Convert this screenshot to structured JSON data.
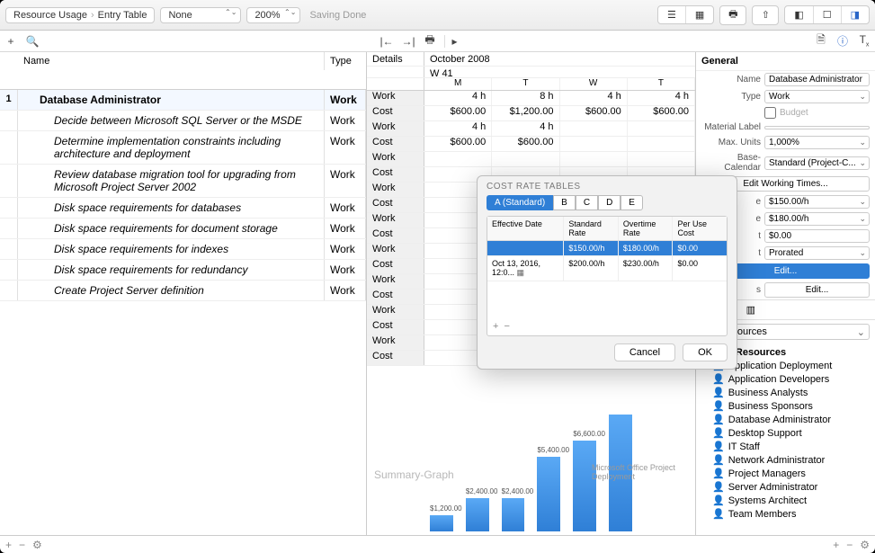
{
  "toolbar": {
    "breadcrumb": [
      "Resource Usage",
      "Entry Table"
    ],
    "filter": "None",
    "zoom": "200%",
    "saving": "Saving Done"
  },
  "left": {
    "headers": {
      "name": "Name",
      "type": "Type"
    },
    "main": {
      "id": "1",
      "name": "Database Administrator",
      "type": "Work"
    },
    "tasks": [
      {
        "name": "Decide between Microsoft SQL Server or the MSDE",
        "type": "Work"
      },
      {
        "name": "Determine implementation constraints including architecture and deployment",
        "type": "Work"
      },
      {
        "name": "Review database migration tool for upgrading from Microsoft Project Server 2002",
        "type": "Work"
      },
      {
        "name": "Disk space requirements for databases",
        "type": "Work"
      },
      {
        "name": "Disk space requirements for document storage",
        "type": "Work"
      },
      {
        "name": "Disk space requirements for indexes",
        "type": "Work"
      },
      {
        "name": "Disk space requirements for redundancy",
        "type": "Work"
      },
      {
        "name": "Create Project Server  definition",
        "type": "Work"
      }
    ]
  },
  "mid": {
    "details_label": "Details",
    "month": "October 2008",
    "week": "W 41",
    "days": [
      "M",
      "T",
      "W",
      "T"
    ],
    "work_label": "Work",
    "cost_label": "Cost",
    "main_work": [
      "4 h",
      "8 h",
      "4 h",
      "4 h"
    ],
    "main_cost": [
      "$600.00",
      "$1,200.00",
      "$600.00",
      "$600.00"
    ],
    "t1_work": [
      "4 h",
      "4 h",
      "",
      ""
    ],
    "t1_cost": [
      "$600.00",
      "$600.00",
      "",
      ""
    ]
  },
  "chart_data": {
    "type": "bar",
    "label": "Summary-Graph",
    "sublabel": "Microsoft Office Project  Deployment",
    "values": [
      1200,
      2400,
      2400,
      5400,
      6600,
      8500
    ],
    "labels": [
      "$1,200.00",
      "$2,400.00",
      "$2,400.00",
      "$5,400.00",
      "$6,600.00",
      ""
    ]
  },
  "inspector": {
    "general": "General",
    "name_label": "Name",
    "name": "Database Administrator",
    "type_label": "Type",
    "type": "Work",
    "budget": "Budget",
    "matlabel_label": "Material Label",
    "matlabel": "",
    "maxunits_label": "Max. Units",
    "maxunits": "1,000%",
    "basecal_label": "Base-Calendar",
    "basecal": "Standard (Project-C...",
    "editwt": "Edit Working Times...",
    "rate1": "$150.00/h",
    "rate2": "$180.00/h",
    "cost0": "$0.00",
    "prorated": "Prorated",
    "edit": "Edit...",
    "allres": "All Resources",
    "treeroot": "Work Resources",
    "tree": [
      "Application Deployment",
      "Application Developers",
      "Business Analysts",
      "Business Sponsors",
      "Database Administrator",
      "Desktop Support",
      "IT Staff",
      "Network Administrator",
      "Project Managers",
      "Server Administrator",
      "Systems Architect",
      "Team Members"
    ]
  },
  "popover": {
    "title": "COST RATE TABLES",
    "tabs": [
      "A (Standard)",
      "B",
      "C",
      "D",
      "E"
    ],
    "headers": [
      "Effective Date",
      "Standard Rate",
      "Overtime Rate",
      "Per Use Cost"
    ],
    "rows": [
      {
        "date": "",
        "std": "$150.00/h",
        "ot": "$180.00/h",
        "per": "$0.00",
        "sel": true
      },
      {
        "date": "Oct 13, 2016, 12:0...",
        "std": "$200.00/h",
        "ot": "$230.00/h",
        "per": "$0.00",
        "sel": false
      }
    ],
    "cancel": "Cancel",
    "ok": "OK"
  }
}
